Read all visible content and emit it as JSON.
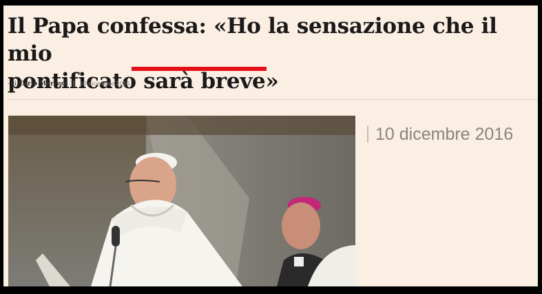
{
  "article": {
    "headline_line1": "Il Papa confessa: «Ho la sensazione che il mio",
    "headline_line2_start": "pontificato ",
    "headline_line2_emph": "sarà breve",
    "headline_line2_end": "»",
    "byline_prefix": "–di",
    "author": "Carlo Marroni",
    "date": "10 dicembre 2016"
  },
  "callout": {
    "date": "10 dicembre 2016"
  },
  "colors": {
    "underline": "#e3101a",
    "background": "#fbeee2"
  }
}
